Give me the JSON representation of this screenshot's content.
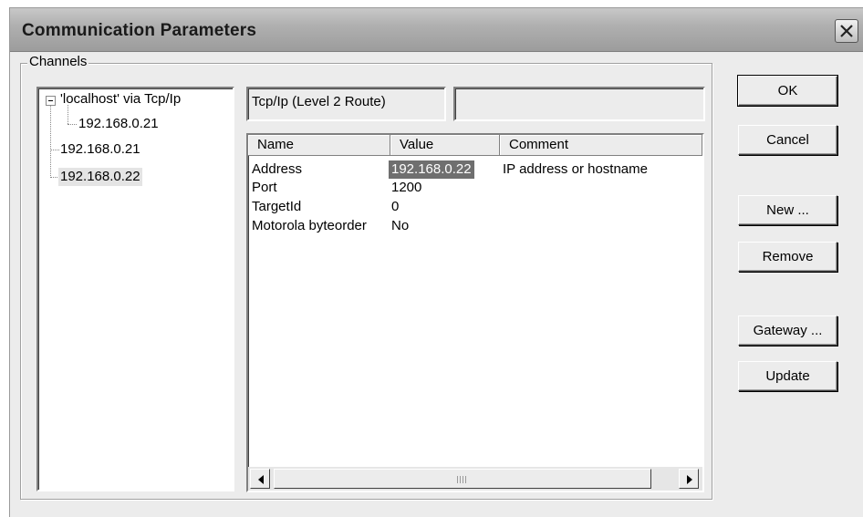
{
  "window": {
    "title": "Communication Parameters"
  },
  "channels": {
    "group_label": "Channels",
    "tree": [
      {
        "label": "'localhost' via Tcp/Ip",
        "level": 0,
        "expanded": true
      },
      {
        "label": "192.168.0.21",
        "level": 1
      },
      {
        "label": "192.168.0.21",
        "level": 0
      },
      {
        "label": "192.168.0.22",
        "level": 0,
        "selected": true
      }
    ]
  },
  "driver": {
    "name": "Tcp/Ip (Level 2 Route)",
    "extra": ""
  },
  "parameters": {
    "columns": [
      "Name",
      "Value",
      "Comment"
    ],
    "rows": [
      {
        "name": "Address",
        "value": "192.168.0.22",
        "comment": "IP address or hostname",
        "selected": true
      },
      {
        "name": "Port",
        "value": "1200",
        "comment": ""
      },
      {
        "name": "TargetId",
        "value": "0",
        "comment": ""
      },
      {
        "name": "Motorola byteorder",
        "value": "No",
        "comment": ""
      }
    ]
  },
  "buttons": {
    "ok": "OK",
    "cancel": "Cancel",
    "new": "New ...",
    "remove": "Remove",
    "gateway": "Gateway ...",
    "update": "Update"
  },
  "colors": {
    "selection": "#6f6f6f",
    "face": "#ececec"
  }
}
